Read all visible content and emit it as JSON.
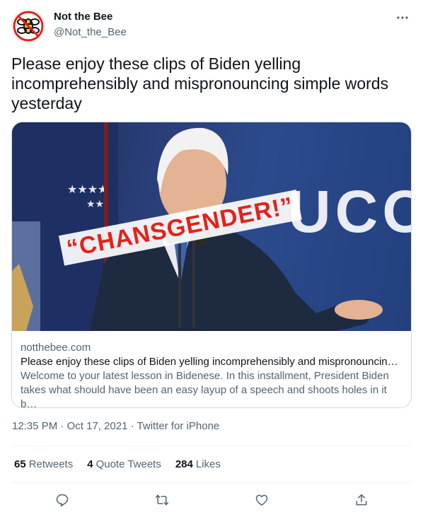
{
  "author": {
    "name": "Not the Bee",
    "handle": "@Not_the_Bee",
    "avatar_icon": "bee-logo-icon"
  },
  "tweet": {
    "text": "Please enjoy these clips of Biden yelling incomprehensibly and mispronouncing simple words yesterday"
  },
  "card": {
    "image_caption": "“CHANSGENDER!”",
    "image_sign_text": "UCO",
    "domain": "notthebee.com",
    "title": "Please enjoy these clips of Biden yelling incomprehensibly and mispronouncing…",
    "description": "Welcome to your latest lesson in Bidenese. In this installment, President Biden takes what should have been an easy layup of a speech and shoots holes in it b…"
  },
  "meta": {
    "time": "12:35 PM",
    "date": "Oct 17, 2021",
    "source": "Twitter for iPhone",
    "separator": "·"
  },
  "stats": {
    "retweets_count": "65",
    "retweets_label": "Retweets",
    "quotes_count": "4",
    "quotes_label": "Quote Tweets",
    "likes_count": "284",
    "likes_label": "Likes"
  },
  "colors": {
    "text_primary": "#0f1419",
    "text_secondary": "#536471",
    "border": "#cfd9de",
    "brand_red": "#e2231a",
    "brand_yellow": "#f5c518"
  }
}
